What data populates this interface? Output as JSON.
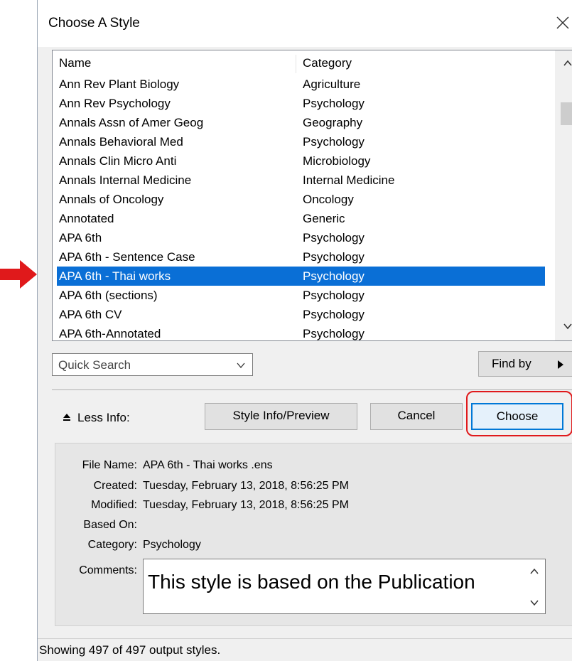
{
  "dialog": {
    "title": "Choose A Style"
  },
  "list": {
    "columns": {
      "name": "Name",
      "category": "Category"
    },
    "rows": [
      {
        "name": "Ann Rev Plant Biology",
        "category": "Agriculture"
      },
      {
        "name": "Ann Rev Psychology",
        "category": "Psychology"
      },
      {
        "name": "Annals Assn of Amer Geog",
        "category": "Geography"
      },
      {
        "name": "Annals Behavioral Med",
        "category": "Psychology"
      },
      {
        "name": "Annals Clin Micro Anti",
        "category": "Microbiology"
      },
      {
        "name": "Annals Internal Medicine",
        "category": "Internal Medicine"
      },
      {
        "name": "Annals of Oncology",
        "category": "Oncology"
      },
      {
        "name": "Annotated",
        "category": "Generic"
      },
      {
        "name": "APA 6th",
        "category": "Psychology"
      },
      {
        "name": "APA 6th - Sentence Case",
        "category": "Psychology"
      },
      {
        "name": "APA 6th - Thai works",
        "category": "Psychology"
      },
      {
        "name": "APA 6th (sections)",
        "category": "Psychology"
      },
      {
        "name": "APA 6th CV",
        "category": "Psychology"
      },
      {
        "name": "APA 6th-Annotated",
        "category": "Psychology"
      }
    ],
    "selected_index": 10
  },
  "quick_search": {
    "value": "Quick Search"
  },
  "find_by": {
    "label": "Find by"
  },
  "buttons": {
    "less_info": "Less Info:",
    "style_info": "Style Info/Preview",
    "cancel": "Cancel",
    "choose": "Choose"
  },
  "info": {
    "file_name_label": "File Name:",
    "file_name": "APA 6th - Thai works .ens",
    "created_label": "Created:",
    "created": "Tuesday, February 13, 2018, 8:56:25 PM",
    "modified_label": "Modified:",
    "modified": "Tuesday, February 13, 2018, 8:56:25 PM",
    "based_on_label": "Based On:",
    "based_on": "",
    "category_label": "Category:",
    "category": "Psychology",
    "comments_label": "Comments:",
    "comments": "This style is based on the Publication"
  },
  "status": "Showing 497 of 497 output styles.",
  "colors": {
    "selection": "#0a6fd6",
    "annotation": "#e0191b",
    "focus": "#0078d7"
  },
  "icons": [
    "close-icon",
    "chevron-up-icon",
    "chevron-down-icon",
    "dropdown-icon",
    "triangle-right-icon",
    "collapse-icon",
    "red-arrow-icon"
  ]
}
